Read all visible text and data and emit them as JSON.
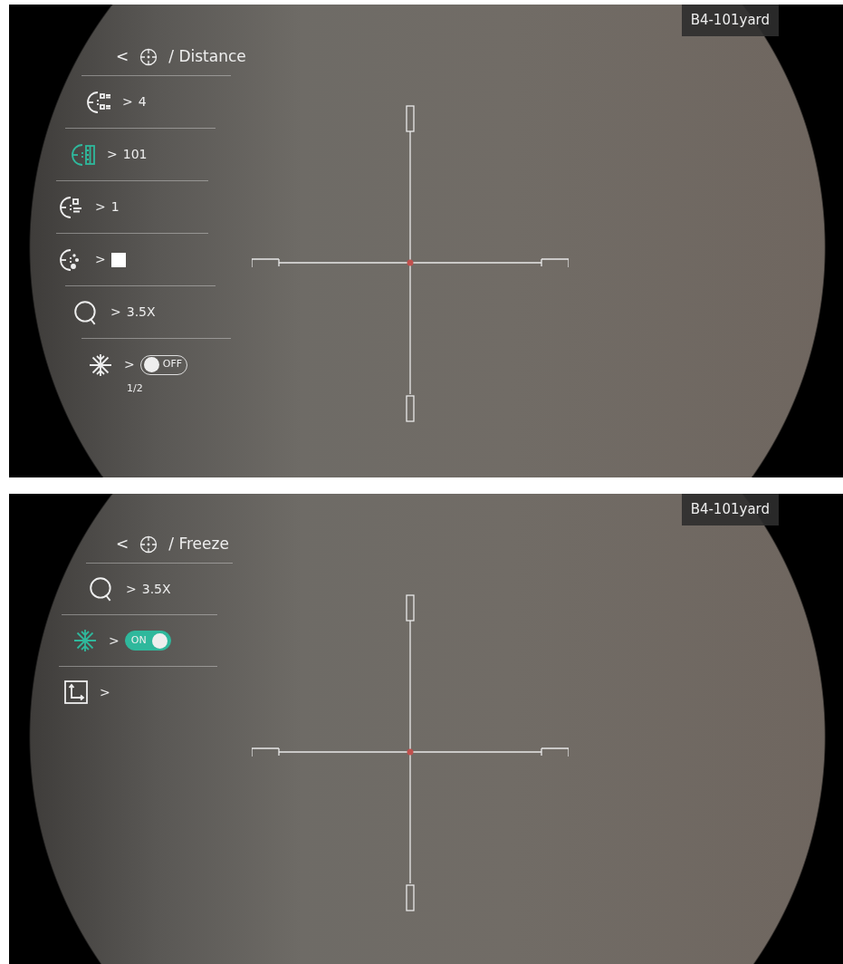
{
  "panels": [
    {
      "header": {
        "back": "<",
        "title": "/ Distance"
      },
      "tag": "B4-101yard",
      "page": "1/2",
      "menu": [
        {
          "kind": "profile",
          "selected": false,
          "arrow": ">",
          "value": "4"
        },
        {
          "kind": "distance",
          "selected": true,
          "arrow": ">",
          "value": "101"
        },
        {
          "kind": "point",
          "selected": false,
          "arrow": ">",
          "value": "1"
        },
        {
          "kind": "color",
          "selected": false,
          "arrow": ">",
          "color": "#ffffff"
        },
        {
          "kind": "zoom",
          "selected": false,
          "arrow": ">",
          "value": "3.5X"
        },
        {
          "kind": "freeze",
          "selected": false,
          "arrow": ">",
          "toggle": {
            "on": false,
            "label": "OFF"
          }
        }
      ]
    },
    {
      "header": {
        "back": "<",
        "title": "/ Freeze"
      },
      "tag": "B4-101yard",
      "menu": [
        {
          "kind": "zoom",
          "selected": false,
          "arrow": ">",
          "value": "3.5X"
        },
        {
          "kind": "freeze",
          "selected": true,
          "arrow": ">",
          "toggle": {
            "on": true,
            "label": "ON"
          }
        },
        {
          "kind": "coordinates",
          "selected": false,
          "arrow": ">"
        }
      ]
    }
  ]
}
